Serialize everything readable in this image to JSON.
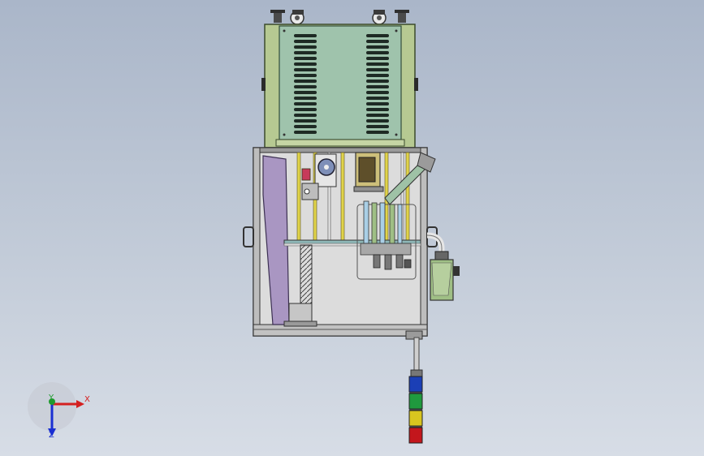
{
  "colors": {
    "background_top": "#aab6c9",
    "background_bottom": "#d7dde6",
    "upper_housing": "#b6c992",
    "upper_panel": "#9fc3ac",
    "frame": "#b9b9b9",
    "side_plate": "#a996c2",
    "cylinder": "#9fbf85",
    "cabinet_gray": "#d8d8d8",
    "x_axis": "#d42020",
    "y_axis": "#1f9b2e",
    "z_axis": "#1a2fd2"
  },
  "signal_tower": {
    "segments": [
      "blue",
      "green",
      "yellow",
      "red"
    ],
    "segment_colors": [
      "#1b3fb6",
      "#1f9a3e",
      "#d8c51f",
      "#c3161c"
    ]
  },
  "triad": {
    "x_label": "X",
    "y_label": "Y",
    "z_label": "Z"
  }
}
